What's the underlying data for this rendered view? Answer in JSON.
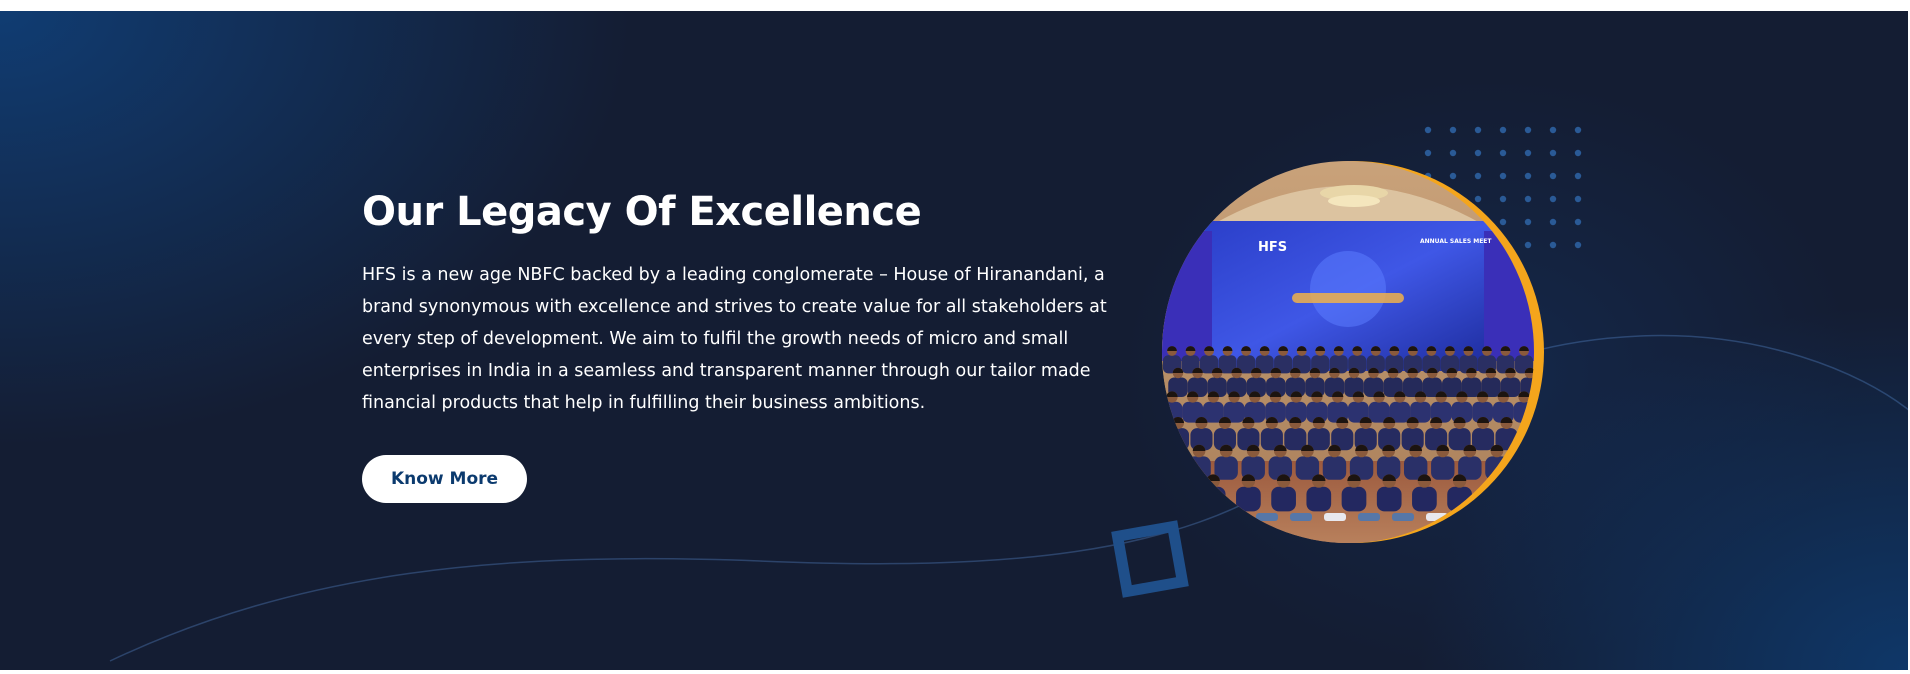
{
  "section": {
    "title": "Our Legacy Of Excellence",
    "description": "HFS is a new age NBFC backed by a leading conglomerate – House of Hiranandani, a brand synonymous with excellence and strives to create value for all stakeholders at every step of development. We aim to fulfil the growth needs of micro and small enterprises in India in a seamless and transparent manner through our tailor made financial products that help in fulfilling their business ambitions.",
    "cta_label": "Know More"
  },
  "photo": {
    "stage_banner_brand": "HFS",
    "stage_banner_event": "ANNUAL SALES MEET"
  },
  "colors": {
    "background_dark": "#141d33",
    "background_blue": "#103e76",
    "accent_ring": "#f4a51c",
    "button_text": "#0b3a6e",
    "dot_grid": "#2a5a96"
  },
  "icons": {
    "decor_dots": "dot-grid-decoration",
    "decor_square": "outline-square-decoration"
  }
}
